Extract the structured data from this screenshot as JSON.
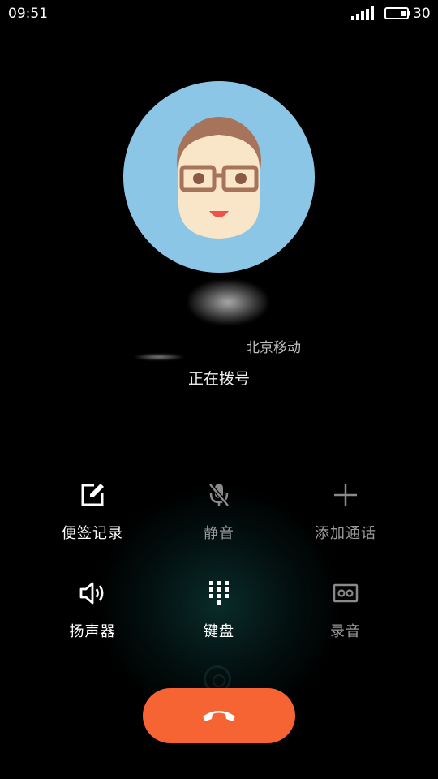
{
  "status_bar": {
    "time": "09:51",
    "battery_level": "30"
  },
  "call": {
    "carrier": "北京移动",
    "status": "正在拨号"
  },
  "actions": [
    {
      "label": "便签记录",
      "icon": "note-edit-icon",
      "enabled": true
    },
    {
      "label": "静音",
      "icon": "mute-mic-icon",
      "enabled": false
    },
    {
      "label": "添加通话",
      "icon": "add-call-icon",
      "enabled": false
    },
    {
      "label": "扬声器",
      "icon": "speaker-icon",
      "enabled": true
    },
    {
      "label": "键盘",
      "icon": "dialpad-icon",
      "enabled": true
    },
    {
      "label": "录音",
      "icon": "record-icon",
      "enabled": false
    }
  ],
  "hangup": {
    "icon": "end-call-icon",
    "color": "#f66434"
  },
  "colors": {
    "avatar_bg": "#8cc6e6",
    "hangup": "#f66434",
    "disabled_label": "#9a9a9a"
  }
}
